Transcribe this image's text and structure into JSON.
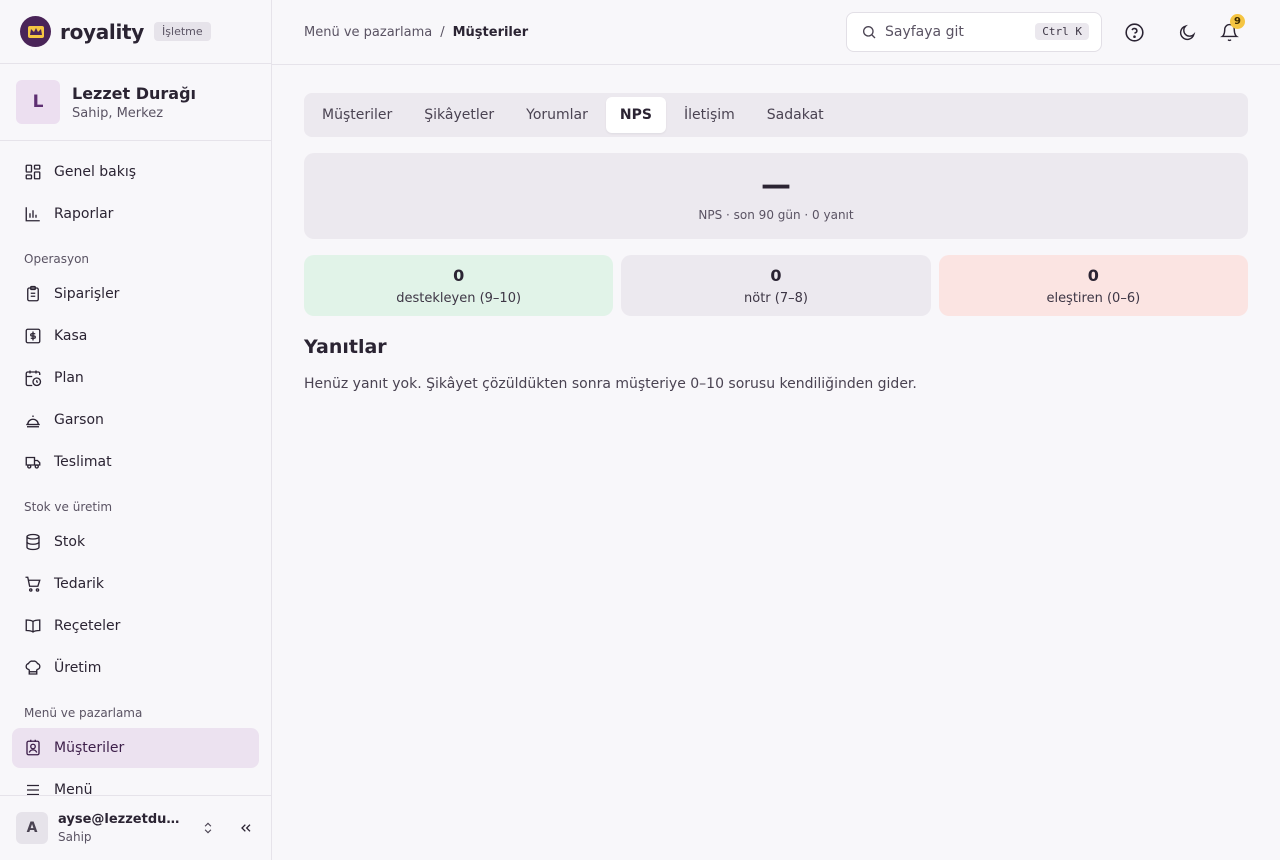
{
  "brand": {
    "name": "royality",
    "badge": "İşletme",
    "logo_color": "#4a2458"
  },
  "org": {
    "initial": "L",
    "name": "Lezzet Durağı",
    "role": "Sahip, Merkez"
  },
  "nav": {
    "top": [
      {
        "label": "Genel bakış",
        "icon": "layout-grid-icon"
      },
      {
        "label": "Raporlar",
        "icon": "bar-chart-icon"
      }
    ],
    "section_operasyon": "Operasyon",
    "operasyon": [
      {
        "label": "Siparişler",
        "icon": "clipboard-icon"
      },
      {
        "label": "Kasa",
        "icon": "dollar-box-icon"
      },
      {
        "label": "Plan",
        "icon": "calendar-clock-icon"
      },
      {
        "label": "Garson",
        "icon": "cloche-icon"
      },
      {
        "label": "Teslimat",
        "icon": "truck-icon"
      }
    ],
    "section_stok": "Stok ve üretim",
    "stok": [
      {
        "label": "Stok",
        "icon": "database-icon"
      },
      {
        "label": "Tedarik",
        "icon": "cart-icon"
      },
      {
        "label": "Reçeteler",
        "icon": "book-icon"
      },
      {
        "label": "Üretim",
        "icon": "chef-hat-icon"
      }
    ],
    "section_menu": "Menü ve pazarlama",
    "menu": [
      {
        "label": "Müşteriler",
        "icon": "contact-icon",
        "active": true
      },
      {
        "label": "Menü",
        "icon": "menu-icon"
      }
    ]
  },
  "user": {
    "initial": "A",
    "email": "ayse@lezzetduragi.com",
    "role": "Sahip"
  },
  "header": {
    "breadcrumb_parent": "Menü ve pazarlama",
    "breadcrumb_sep": "/",
    "breadcrumb_current": "Müşteriler",
    "search_placeholder": "Sayfaya git",
    "shortcut": "Ctrl K",
    "notification_count": "9"
  },
  "tabs": [
    {
      "label": "Müşteriler",
      "active": false
    },
    {
      "label": "Şikâyetler",
      "active": false
    },
    {
      "label": "Yorumlar",
      "active": false
    },
    {
      "label": "NPS",
      "active": true
    },
    {
      "label": "İletişim",
      "active": false
    },
    {
      "label": "Sadakat",
      "active": false
    }
  ],
  "nps": {
    "score": "—",
    "subtitle": "NPS · son 90 gün · 0 yanıt"
  },
  "stats": [
    {
      "value": "0",
      "label": "destekleyen (9–10)",
      "color": "#e1f3e8"
    },
    {
      "value": "0",
      "label": "nötr (7–8)",
      "color": "#ece9ef"
    },
    {
      "value": "0",
      "label": "eleştiren (0–6)",
      "color": "#fbe4e2"
    }
  ],
  "responses": {
    "title": "Yanıtlar",
    "empty": "Henüz yanıt yok. Şikâyet çözüldükten sonra müşteriye 0–10 sorusu kendiliğinden gider."
  }
}
